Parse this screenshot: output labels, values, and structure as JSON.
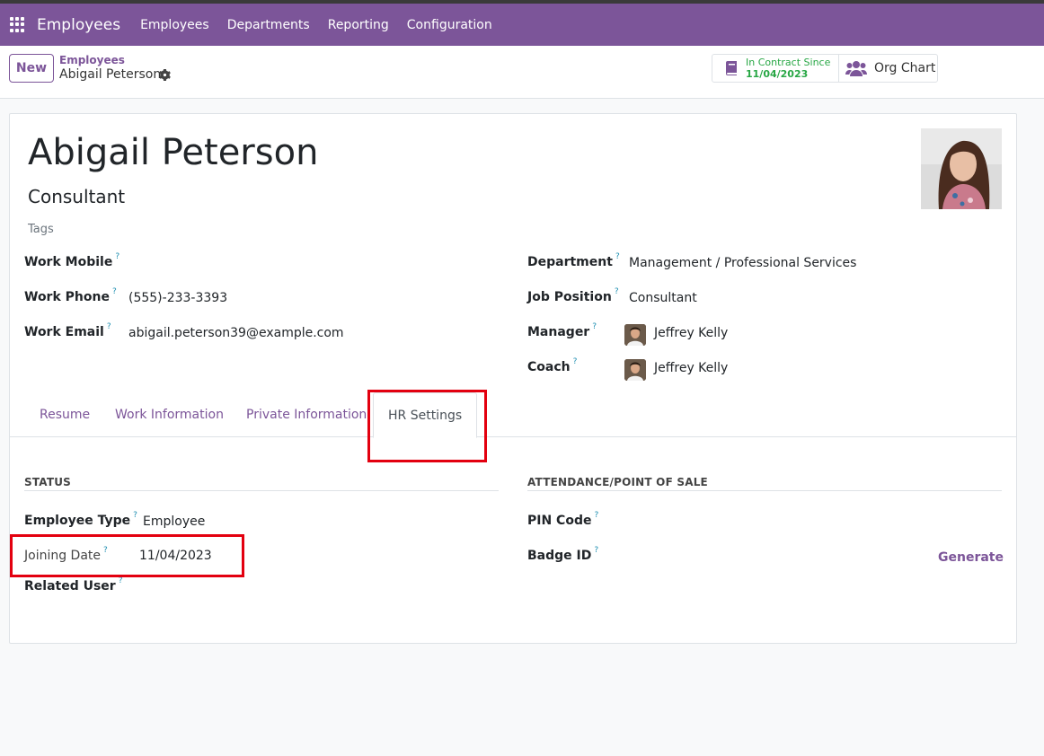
{
  "navbar": {
    "app_name": "Employees",
    "menu": [
      "Employees",
      "Departments",
      "Reporting",
      "Configuration"
    ]
  },
  "control_panel": {
    "new_label": "New",
    "breadcrumb_parent": "Employees",
    "breadcrumb_current": "Abigail Peterson",
    "contract_stat_label": "In Contract Since",
    "contract_stat_value": "11/04/2023",
    "org_chart_label": "Org Chart"
  },
  "employee": {
    "name": "Abigail Peterson",
    "job_title": "Consultant",
    "tags_placeholder": "Tags",
    "work_mobile_label": "Work Mobile",
    "work_phone_label": "Work Phone",
    "work_phone": "(555)-233-3393",
    "work_email_label": "Work Email",
    "work_email": "abigail.peterson39@example.com",
    "department_label": "Department",
    "department": "Management / Professional Services",
    "job_position_label": "Job Position",
    "job_position": "Consultant",
    "manager_label": "Manager",
    "manager": "Jeffrey Kelly",
    "coach_label": "Coach",
    "coach": "Jeffrey Kelly"
  },
  "tabs": [
    "Resume",
    "Work Information",
    "Private Information",
    "HR Settings"
  ],
  "active_tab": "HR Settings",
  "hr_settings": {
    "status_title": "STATUS",
    "employee_type_label": "Employee Type",
    "employee_type": "Employee",
    "joining_date_label": "Joining Date",
    "joining_date": "11/04/2023",
    "related_user_label": "Related User",
    "attendance_title": "ATTENDANCE/POINT OF SALE",
    "pin_code_label": "PIN Code",
    "badge_id_label": "Badge ID",
    "generate_label": "Generate"
  },
  "help_mark": "?",
  "colors": {
    "brand": "#7c5599",
    "success": "#28a745",
    "highlight": "#e3000f"
  }
}
